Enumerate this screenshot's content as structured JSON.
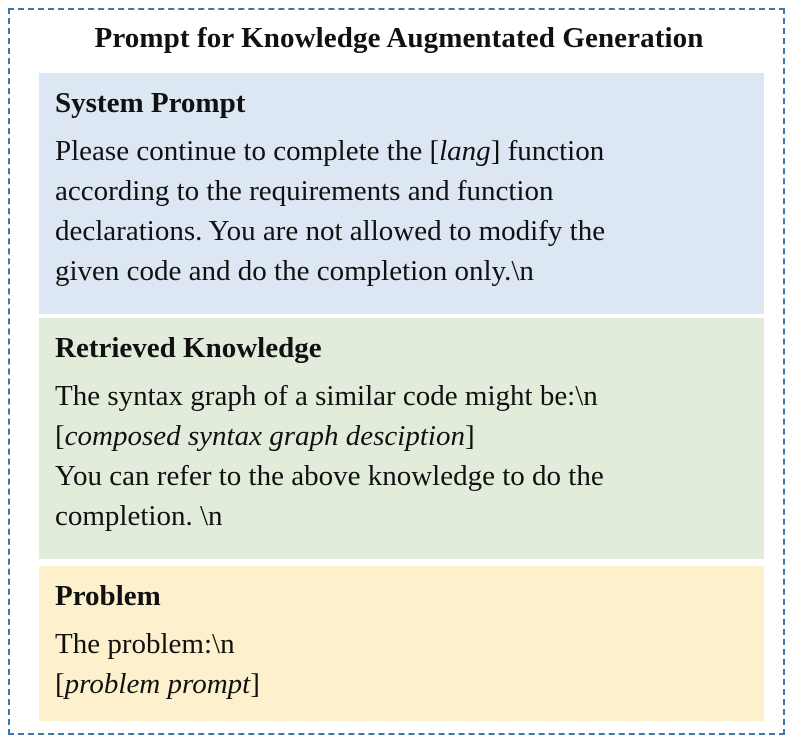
{
  "title": "Prompt for Knowledge Augmentated Generation",
  "sections": {
    "system": {
      "title": "System Prompt",
      "line1_pre": "Please continue to complete the [",
      "line1_var": "lang",
      "line1_post": "] function",
      "line2": "according to the requirements and function",
      "line3": "declarations. You are not allowed to modify the",
      "line4": "given code and do the completion only.\\n"
    },
    "knowledge": {
      "title": "Retrieved Knowledge",
      "line1": "The syntax graph of a similar code might be:\\n",
      "line2_pre": "[",
      "line2_var": "composed syntax graph desciption",
      "line2_post": "]",
      "line3": "You can refer to the above knowledge to do the",
      "line4": "completion. \\n"
    },
    "problem": {
      "title": "Problem",
      "line1": "The problem:\\n",
      "line2_pre": "[",
      "line2_var": "problem prompt",
      "line2_post": "]"
    }
  },
  "colors": {
    "border": "#3f77ad",
    "system_bg": "#dce7f3",
    "knowledge_bg": "#e1ecda",
    "problem_bg": "#fdf1cd"
  }
}
